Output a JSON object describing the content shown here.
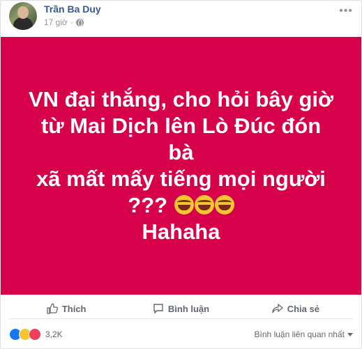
{
  "post": {
    "author": "Trần Ba Duy",
    "time": "17 giờ",
    "separator": "·",
    "more_label": "•••",
    "lines": [
      "VN đại thắng, cho hỏi bây giờ",
      "từ Mai Dịch lên Lò Đúc đón bà",
      "xã mất mấy tiếng mọi người",
      "???",
      "Hahaha"
    ],
    "background_color": "#d7004a"
  },
  "actions": {
    "like_label": "Thích",
    "comment_label": "Bình luận",
    "share_label": "Chia sẻ"
  },
  "footer": {
    "reaction_count": "3,2K",
    "sort_label": "Bình luận liên quan nhất"
  }
}
